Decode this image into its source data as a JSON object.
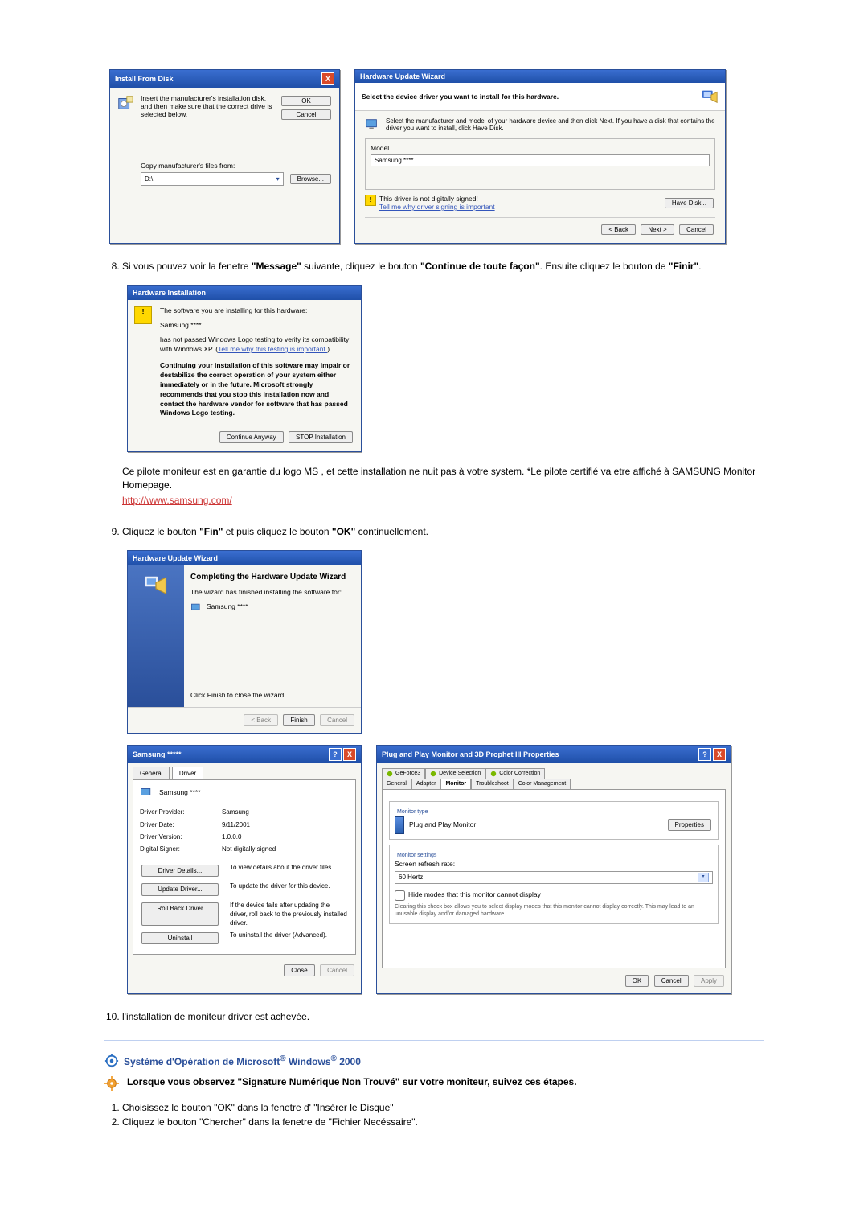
{
  "install_from_disk": {
    "title": "Install From Disk",
    "instruction": "Insert the manufacturer's installation disk, and then make sure that the correct drive is selected below.",
    "ok": "OK",
    "cancel": "Cancel",
    "copy_label": "Copy manufacturer's files from:",
    "path": "D:\\",
    "browse": "Browse..."
  },
  "hw_wizard_select": {
    "title": "Hardware Update Wizard",
    "heading": "Select the device driver you want to install for this hardware.",
    "text": "Select the manufacturer and model of your hardware device and then click Next. If you have a disk that contains the driver you want to install, click Have Disk.",
    "model_label": "Model",
    "model_value": "Samsung ****",
    "not_signed": "This driver is not digitally signed!",
    "tell_me": "Tell me why driver signing is important",
    "have_disk": "Have Disk...",
    "back": "< Back",
    "next": "Next >",
    "cancel": "Cancel"
  },
  "step8_text_a": "Si vous pouvez voir la fenetre ",
  "step8_bold1": "\"Message\"",
  "step8_text_b": " suivante, cliquez le bouton ",
  "step8_bold2": "\"Continue de toute façon\"",
  "step8_text_c": ". Ensuite cliquez le bouton de ",
  "step8_bold3": "\"Finir\"",
  "step8_text_d": ".",
  "hw_install": {
    "title": "Hardware Installation",
    "line1": "The software you are installing for this hardware:",
    "device": "Samsung ****",
    "line2a": "has not passed Windows Logo testing to verify its compatibility with Windows XP. (",
    "line2_link": "Tell me why this testing is important.",
    "line2b": ")",
    "warn": "Continuing your installation of this software may impair or destabilize the correct operation of your system either immediately or in the future. Microsoft strongly recommends that you stop this installation now and contact the hardware vendor for software that has passed Windows Logo testing.",
    "continue": "Continue Anyway",
    "stop": "STOP Installation"
  },
  "para_after8_a": "Ce pilote moniteur est en garantie du logo MS , et cette installation ne nuit pas à votre system. *Le pilote certifié va etre affiché à SAMSUNG Monitor Homepage.",
  "samsung_link": "http://www.samsung.com/",
  "step9_text_a": "Cliquez le bouton ",
  "step9_bold1": "\"Fin\"",
  "step9_text_b": " et puis cliquez le bouton ",
  "step9_bold2": "\"OK\"",
  "step9_text_c": " continuellement.",
  "wizard_complete": {
    "title": "Hardware Update Wizard",
    "heading": "Completing the Hardware Update Wizard",
    "line1": "The wizard has finished installing the software for:",
    "device": "Samsung ****",
    "line2": "Click Finish to close the wizard.",
    "back": "< Back",
    "finish": "Finish",
    "cancel": "Cancel"
  },
  "driver_props": {
    "title": "Samsung *****",
    "tab_general": "General",
    "tab_driver": "Driver",
    "device": "Samsung ****",
    "provider_lbl": "Driver Provider:",
    "provider": "Samsung",
    "date_lbl": "Driver Date:",
    "date": "9/11/2001",
    "version_lbl": "Driver Version:",
    "version": "1.0.0.0",
    "signer_lbl": "Digital Signer:",
    "signer": "Not digitally signed",
    "details_btn": "Driver Details...",
    "details_txt": "To view details about the driver files.",
    "update_btn": "Update Driver...",
    "update_txt": "To update the driver for this device.",
    "rollback_btn": "Roll Back Driver",
    "rollback_txt": "If the device fails after updating the driver, roll back to the previously installed driver.",
    "uninstall_btn": "Uninstall",
    "uninstall_txt": "To uninstall the driver (Advanced).",
    "close": "Close",
    "cancel": "Cancel"
  },
  "pnp_props": {
    "title": "Plug and Play Monitor and 3D Prophet III Properties",
    "tabs": {
      "gf": "GeForce3",
      "devsel": "Device Selection",
      "color": "Color Correction",
      "general": "General",
      "adapter": "Adapter",
      "monitor": "Monitor",
      "troubleshoot": "Troubleshoot",
      "colormgmt": "Color Management"
    },
    "monitor_type_lbl": "Monitor type",
    "monitor_type": "Plug and Play Monitor",
    "properties": "Properties",
    "settings_lbl": "Monitor settings",
    "refresh_lbl": "Screen refresh rate:",
    "refresh_val": "60 Hertz",
    "hide_modes": "Hide modes that this monitor cannot display",
    "hide_modes_txt": "Clearing this check box allows you to select display modes that this monitor cannot display correctly. This may lead to an unusable display and/or damaged hardware.",
    "ok": "OK",
    "cancel": "Cancel",
    "apply": "Apply"
  },
  "step10": "l'installation de moniteur driver est achevée.",
  "section_2000_a": "Système d'Opération de Microsoft",
  "section_2000_b": " Windows",
  "section_2000_c": " 2000",
  "sub_instruction": "Lorsque vous observez \"Signature Numérique Non Trouvé\" sur votre moniteur, suivez ces étapes.",
  "sub1": "Choisissez le bouton \"OK\" dans la fenetre d' \"Insérer le Disque\"",
  "sub2": "Cliquez le bouton \"Chercher\" dans la fenetre de \"Fichier Necéssaire\"."
}
